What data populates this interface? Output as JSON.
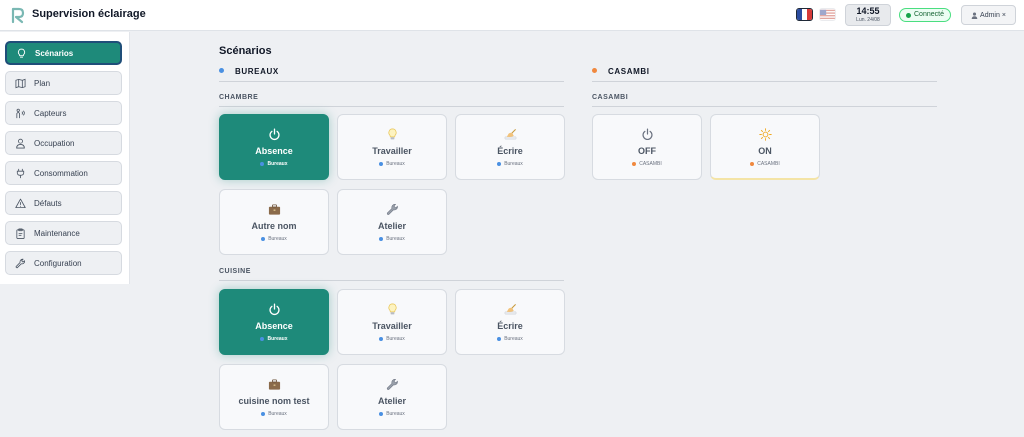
{
  "header": {
    "title": "Supervision éclairage",
    "lang_fr": "flag-fr-icon",
    "lang_en": "flag-en-icon",
    "time": "14:55",
    "date": "Lun. 24/08",
    "status": "Connecté",
    "user": "Admin",
    "user_close": "×"
  },
  "sidebar": {
    "items": [
      {
        "label": "Scénarios",
        "icon": "lightbulb-icon"
      },
      {
        "label": "Plan",
        "icon": "map-icon"
      },
      {
        "label": "Capteurs",
        "icon": "sensor-icon"
      },
      {
        "label": "Occupation",
        "icon": "person-icon"
      },
      {
        "label": "Consommation",
        "icon": "plug-icon"
      },
      {
        "label": "Défauts",
        "icon": "warning-icon"
      },
      {
        "label": "Maintenance",
        "icon": "clipboard-icon"
      },
      {
        "label": "Configuration",
        "icon": "wrench-icon"
      }
    ]
  },
  "main": {
    "title": "Scénarios",
    "groups": [
      {
        "name": "BUREAUX",
        "color": "#4a90e2",
        "rooms": [
          {
            "name": "CHAMBRE",
            "cards": [
              {
                "name": "Absence",
                "tag": "Bureaux",
                "icon": "power-icon",
                "active": true
              },
              {
                "name": "Travailler",
                "tag": "Bureaux",
                "icon": "lightbulb-icon"
              },
              {
                "name": "Écrire",
                "tag": "Bureaux",
                "icon": "writing-hand-icon"
              },
              {
                "name": "Autre nom",
                "tag": "Bureaux",
                "icon": "briefcase-icon"
              },
              {
                "name": "Atelier",
                "tag": "Bureaux",
                "icon": "wrench-icon"
              }
            ]
          },
          {
            "name": "CUISINE",
            "cards": [
              {
                "name": "Absence",
                "tag": "Bureaux",
                "icon": "power-icon",
                "active": true
              },
              {
                "name": "Travailler",
                "tag": "Bureaux",
                "icon": "lightbulb-icon"
              },
              {
                "name": "Écrire",
                "tag": "Bureaux",
                "icon": "writing-hand-icon"
              },
              {
                "name": "cuisine nom test",
                "tag": "Bureaux",
                "icon": "briefcase-icon"
              },
              {
                "name": "Atelier",
                "tag": "Bureaux",
                "icon": "wrench-icon"
              }
            ]
          }
        ]
      },
      {
        "name": "CASAMBI",
        "color": "#f0883e",
        "rooms": [
          {
            "name": "CASAMBI",
            "cards": [
              {
                "name": "OFF",
                "tag": "CASAMBI",
                "icon": "power-icon"
              },
              {
                "name": "ON",
                "tag": "CASAMBI",
                "icon": "sun-icon"
              }
            ]
          }
        ]
      }
    ]
  },
  "colors": {
    "accent": "#1e8a7a",
    "active_border": "#1f4e79",
    "connected": "#16a34a"
  }
}
